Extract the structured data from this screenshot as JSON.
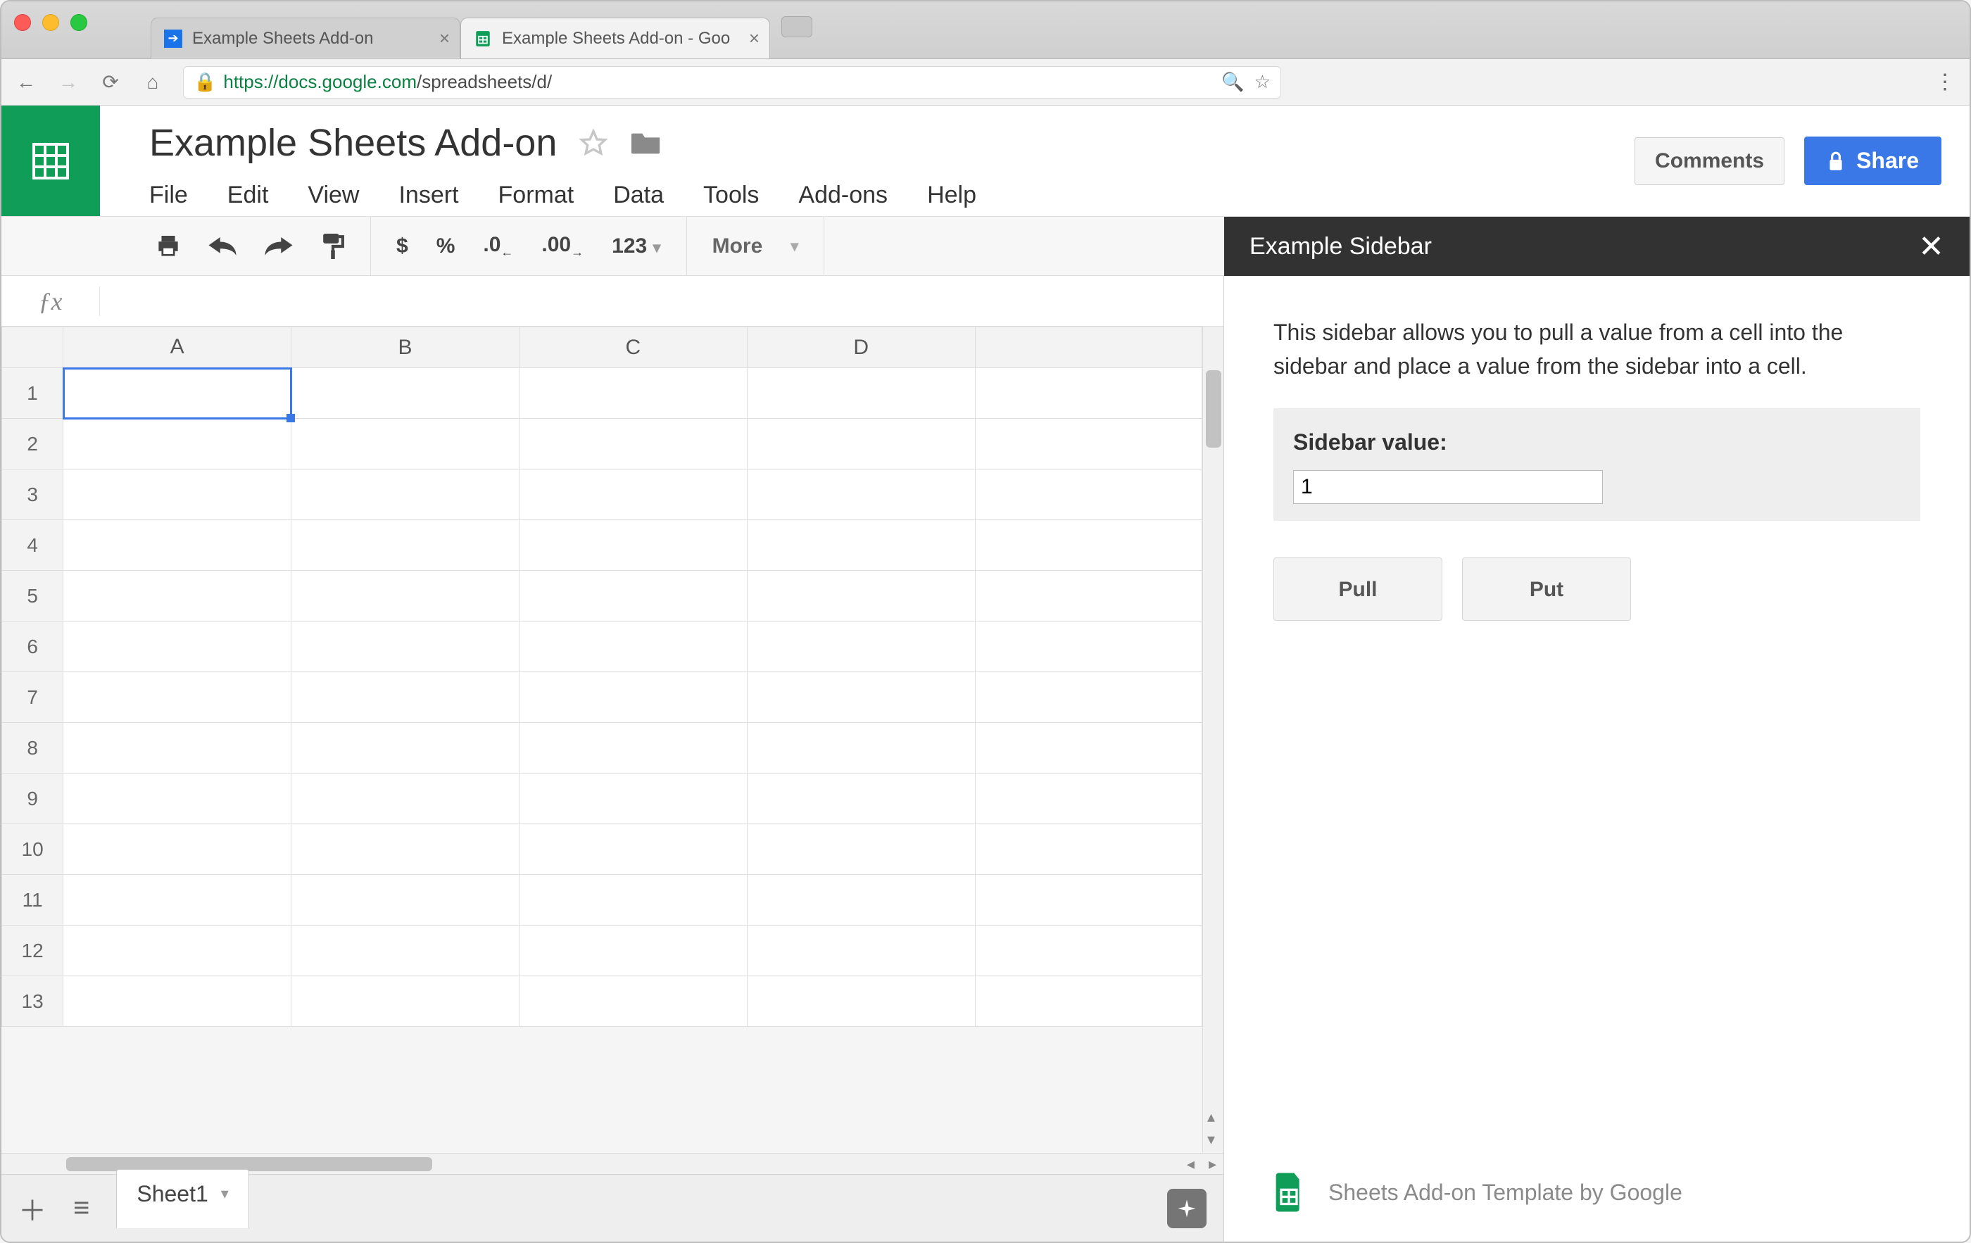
{
  "browser": {
    "tabs": [
      {
        "title": "Example Sheets Add-on",
        "active": false
      },
      {
        "title": "Example Sheets Add-on - Goo",
        "active": true
      }
    ],
    "url_host": "https://docs.google.com",
    "url_path": "/spreadsheets/d/",
    "kebab": "⋮"
  },
  "doc": {
    "title": "Example Sheets Add-on",
    "menus": [
      "File",
      "Edit",
      "View",
      "Insert",
      "Format",
      "Data",
      "Tools",
      "Add-ons",
      "Help"
    ],
    "comments_label": "Comments",
    "share_label": "Share"
  },
  "toolbar": {
    "currency": "$",
    "percent": "%",
    "dec_dec": ".0",
    "inc_dec": ".00",
    "num_fmt": "123",
    "more": "More"
  },
  "formula": {
    "value": ""
  },
  "grid": {
    "cols": [
      "A",
      "B",
      "C",
      "D",
      ""
    ],
    "rows": 13,
    "selected": {
      "row": 1,
      "col": "A"
    }
  },
  "sidebar": {
    "title": "Example Sidebar",
    "description": "This sidebar allows you to pull a value from a cell into the sidebar and place a value from the sidebar into a cell.",
    "value_label": "Sidebar value:",
    "value": "1",
    "pull_label": "Pull",
    "put_label": "Put",
    "footer": "Sheets Add-on Template by Google"
  },
  "footer": {
    "sheet_tab": "Sheet1"
  }
}
